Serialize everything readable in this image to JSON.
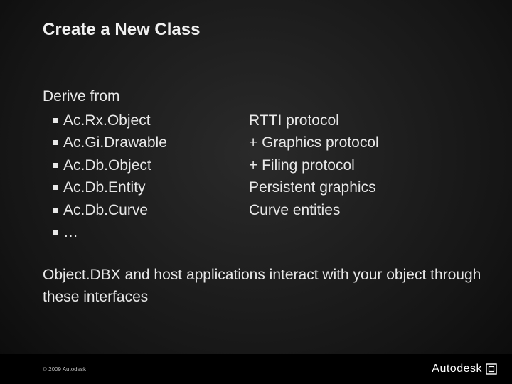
{
  "title": "Create a New Class",
  "intro": "Derive from",
  "items": [
    {
      "left": "Ac.Rx.Object",
      "right": "RTTI protocol"
    },
    {
      "left": "Ac.Gi.Drawable",
      "right": "+ Graphics protocol"
    },
    {
      "left": "Ac.Db.Object",
      "right": "+ Filing protocol"
    },
    {
      "left": "Ac.Db.Entity",
      "right": "Persistent graphics"
    },
    {
      "left": "Ac.Db.Curve",
      "right": "Curve entities"
    },
    {
      "left": "…",
      "right": ""
    }
  ],
  "closing": "Object.DBX and host applications interact with your object through these interfaces",
  "footer": {
    "copyright": "© 2009 Autodesk",
    "logo_text": "Autodesk"
  }
}
